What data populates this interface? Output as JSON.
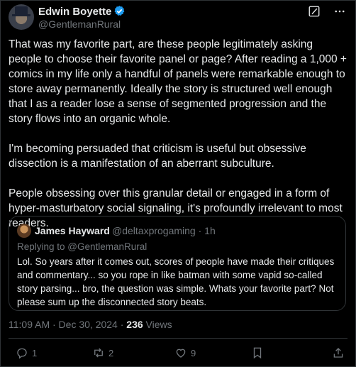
{
  "author": {
    "name": "Edwin Boyette",
    "handle": "@GentlemanRural",
    "verified": true
  },
  "header_icons": [
    "grok-icon",
    "more-icon"
  ],
  "post": {
    "paragraphs": [
      "That was my favorite part, are these people legitimately asking people to choose their favorite panel or page? After reading a 1,000 + comics in my life only a handful of panels were remarkable enough to store away permanently. Ideally the story is structured well enough that I as a reader lose a sense of segmented progression and the story flows into an organic whole.",
      "I'm becoming persuaded that criticism is useful but obsessive dissection is a manifestation of an aberrant subculture.",
      "People obsessing over this granular detail or engaged in a form of hyper-masturbatory social signaling, it's profoundly irrelevant to most readers."
    ]
  },
  "quote": {
    "name": "James Hayward",
    "handle_time": "@deltaxprogaming · 1h",
    "replying_to": "Replying to @GentlemanRural",
    "text": "Lol. So years after it comes out, scores of people have made their critiques and commentary... so you rope in like batman with some vapid so-called story parsing... bro, the question was simple. Whats your favorite part? Not please sum up the disconnected story beats."
  },
  "meta": {
    "timestamp": "11:09 AM · Dec 30, 2024 · ",
    "views_count": "236",
    "views_label": " Views"
  },
  "actions": {
    "reply_count": "1",
    "repost_count": "2",
    "like_count": "9"
  },
  "colors": {
    "background": "#000000",
    "text": "#e7e9ea",
    "muted": "#71767b",
    "border": "#2f3336",
    "verified": "#1d9bf0"
  }
}
